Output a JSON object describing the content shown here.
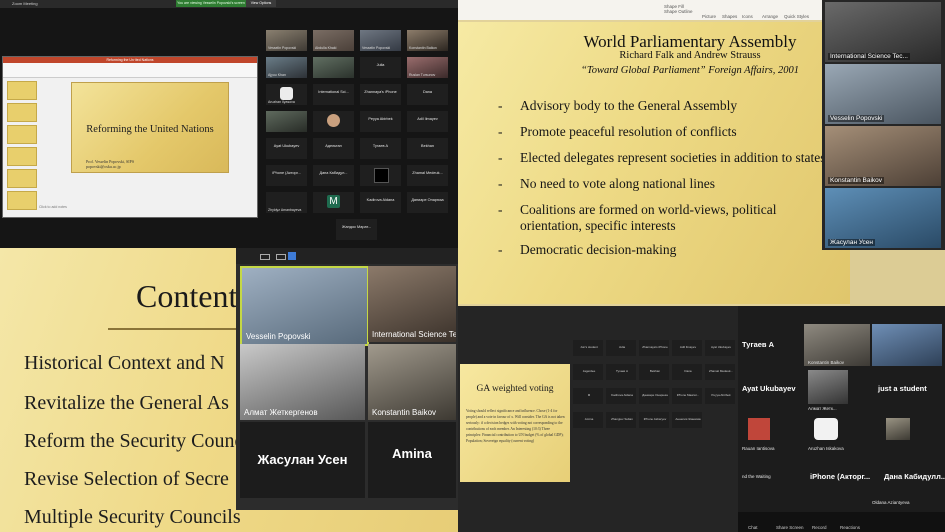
{
  "panel1": {
    "window_title": "Zoom Meeting",
    "banner_text": "You are viewing Vesselin Popovski's screen",
    "view_options": "View Options",
    "ppt_title": "Reforming the Un·ited Nations",
    "slide_title": "Reforming the United Nations",
    "slide_author_1": "Prof. Vesselin Popovski, SIPS",
    "slide_author_2": "popovski@osku.ac.jp",
    "notes": "Click to add notes",
    "tiles": [
      {
        "name": "Vesselin Popovski",
        "label": ""
      },
      {
        "name": "Abdulla Khaki",
        "label": ""
      },
      {
        "name": "Vesselin Popovski",
        "label": ""
      },
      {
        "name": "Konstantin Baikov",
        "label": ""
      },
      {
        "name": "Ajyuu Khan",
        "label": ""
      },
      {
        "name": "",
        "label": "Julia"
      },
      {
        "name": "Ruslan Tursunov",
        "label": ""
      },
      {
        "name": "Aruzhan Ilyasova",
        "label": ""
      },
      {
        "name": "",
        "label": "International Sci..."
      },
      {
        "name": "",
        "label": "Zhannaya's iPhone"
      },
      {
        "name": "",
        "label": "Dana"
      },
      {
        "name": "",
        "label": ""
      },
      {
        "name": "",
        "label": "Peyya Abirbek"
      },
      {
        "name": "",
        "label": "Adil Ilmayev"
      },
      {
        "name": "",
        "label": "Ayat Ukubayev"
      },
      {
        "name": "",
        "label": "Адельтан"
      },
      {
        "name": "",
        "label": "Тугаев А"
      },
      {
        "name": "",
        "label": "Bekhan"
      },
      {
        "name": "",
        "label": "iPhone (Акторг..."
      },
      {
        "name": "",
        "label": "Дана Кабидул..."
      },
      {
        "name": "",
        "label": ""
      },
      {
        "name": "",
        "label": "Zhamal Medeuk..."
      },
      {
        "name": "Zhyldyz Amanbayeva",
        "label": ""
      },
      {
        "name": "",
        "label": "M"
      },
      {
        "name": "",
        "label": "Kadirova Aidana"
      },
      {
        "name": "",
        "label": "Даниаре Онарюза"
      },
      {
        "name": "",
        "label": "Жандос Марат..."
      }
    ]
  },
  "panel2": {
    "ribbon": [
      "Picture",
      "Shapes",
      "Icons",
      "Arrange",
      "Quick Styles",
      "Shape Fill",
      "Shape Outline"
    ],
    "slide_title": "World Parliamentary Assembly",
    "authors": "Richard Falk and Andrew Strauss",
    "citation": "“Toward Global Parliament” Foreign Affairs, 2001",
    "bullets": [
      "Advisory body to the General Assembly",
      "Promote peaceful resolution of conflicts",
      "Elected delegates represent societies in addition to states",
      "No need to vote along national lines",
      "Coalitions are formed on world-views, political orientation, specific interests",
      "Democratic decision-making"
    ],
    "participants": [
      "International Science Tec...",
      "Vesselin Popovski",
      "Konstantin Baikov",
      "Жасулан Усен"
    ]
  },
  "panel3": {
    "heading": "Content",
    "items": [
      "Historical Context and N",
      "Revitalize the General As",
      "Reform the Security Counc",
      "Revise Selection of Secre",
      "Multiple Security Councils"
    ],
    "tiles": [
      {
        "name": "Vesselin Popovski",
        "center": ""
      },
      {
        "name": "International Science Tec...",
        "center": ""
      },
      {
        "name": "Алмат Жеткергенов",
        "center": ""
      },
      {
        "name": "Konstantin Baikov",
        "center": ""
      },
      {
        "name": "",
        "center": "Жасулан Усен"
      },
      {
        "name": "",
        "center": "Amina"
      }
    ]
  },
  "panel4": {
    "slide_title": "GA weighted voting",
    "slide_body": "Voting should reflect significance and influence. Chose (1-4 for people) and a vote in favour of x. Will consider. The GA is not taken seriously: if a decision hedges with voting not corresponding to the contributions of each member. An Interesting (10:3) Three principles: Financial contribution to UN budget (% of global GDP); Population; Sovereign equality (current voting)",
    "grid": [
      "Jun's student",
      "Julia",
      "Zhannaya's iPhone",
      "Adil Ilmayev",
      "Ayat Ukubayev",
      "Jagerdee",
      "Тугаев А",
      "Bekhan",
      "Dana",
      "Zhamal Medeuk...",
      "M",
      "Kadirova Aidana",
      "Даниаре Онарюза",
      "iPhone Максат...",
      "Peyya Abirbek",
      "Amina",
      "Zhangiev Sultan",
      "iPhone Asbaryev",
      "Аннелия Жанкова"
    ],
    "right_names": [
      "Тугаев А",
      "Ayat Ukubayev",
      "just a student",
      "iPhone (Акторг...",
      "Дана Кабидулл...",
      "nd the Waiting"
    ],
    "right_small": [
      "Konstantin Baikov",
      "Алмат Жетк...",
      "Aruzhan Iskakova",
      "Rauan Iantisova",
      "Oldana Aziantyeva"
    ],
    "toolbar": [
      "Chat",
      "Share Screen",
      "Record",
      "Reactions"
    ]
  }
}
